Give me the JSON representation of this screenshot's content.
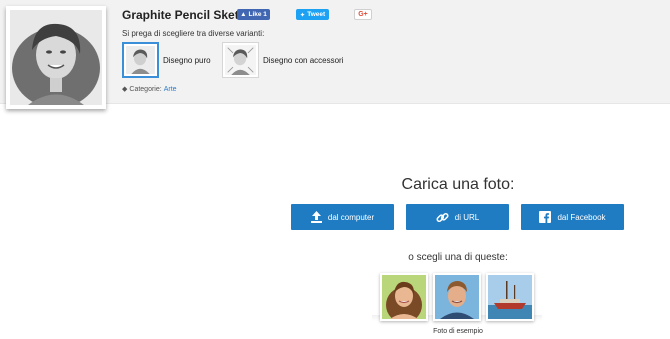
{
  "effect": {
    "title": "Graphite Pencil Sketch",
    "social": {
      "like_label": "Like 1",
      "tweet_label": "Tweet",
      "gplus_label": "G+"
    },
    "prompt": "Si prega di scegliere tra diverse varianti:",
    "variants": [
      {
        "label": "Disegno puro",
        "selected": true
      },
      {
        "label": "Disegno con accessori",
        "selected": false
      }
    ],
    "category": {
      "prefix": "Categorie:",
      "link": "Arte"
    }
  },
  "upload": {
    "title": "Carica una foto:",
    "buttons": [
      {
        "label": "dal computer",
        "icon": "upload-icon"
      },
      {
        "label": "di URL",
        "icon": "link-icon"
      },
      {
        "label": "dal Facebook",
        "icon": "facebook-icon"
      }
    ],
    "choose_label": "o scegli una di queste:",
    "samples_caption": "Foto di esempio",
    "accent_color": "#1f7cc3"
  }
}
